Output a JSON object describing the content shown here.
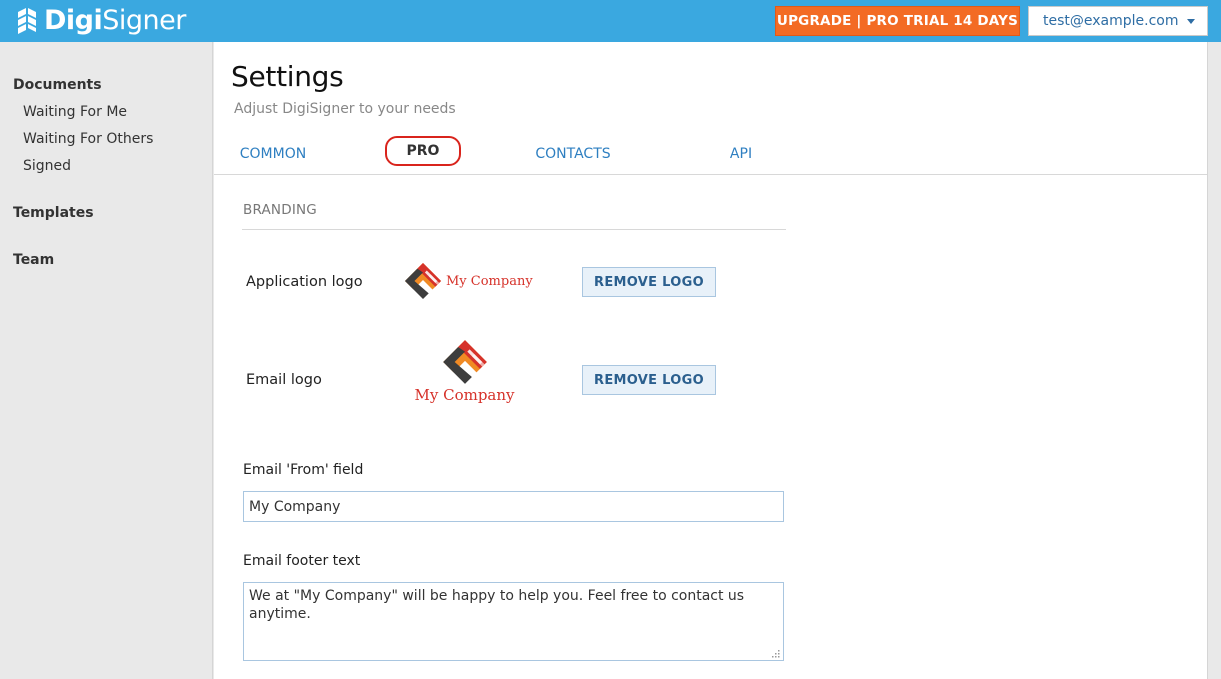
{
  "header": {
    "brand": {
      "bold": "Digi",
      "light": "Signer"
    },
    "upgrade_label": "UPGRADE | PRO TRIAL 14 DAYS",
    "user_email": "test@example.com"
  },
  "sidebar": {
    "documents": {
      "label": "Documents",
      "items": [
        "Waiting For Me",
        "Waiting For Others",
        "Signed"
      ]
    },
    "templates_label": "Templates",
    "team_label": "Team"
  },
  "main": {
    "title": "Settings",
    "subtitle": "Adjust DigiSigner to your needs",
    "tabs": [
      {
        "label": "COMMON",
        "active": false
      },
      {
        "label": "PRO",
        "active": true
      },
      {
        "label": "CONTACTS",
        "active": false
      },
      {
        "label": "API",
        "active": false
      }
    ],
    "branding": {
      "section_label": "BRANDING",
      "application_logo": {
        "label": "Application logo",
        "logo_text": "My Company",
        "button_label": "REMOVE LOGO"
      },
      "email_logo": {
        "label": "Email logo",
        "logo_text": "My Company",
        "button_label": "REMOVE LOGO"
      },
      "email_from": {
        "label": "Email 'From' field",
        "value": "My Company"
      },
      "email_footer": {
        "label": "Email footer text",
        "value": "We at \"My Company\" will be happy to help you. Feel free to contact us anytime."
      }
    }
  },
  "colors": {
    "header_bg": "#3aa8e0",
    "upgrade_bg": "#f36b24",
    "link_blue": "#2e7fc1",
    "active_tab_ring": "#d9241c",
    "logo_red": "#d6322a",
    "logo_orange": "#f08a24",
    "logo_dark": "#3d3d3d"
  },
  "icons": {
    "brand": "digisigner-logo-icon",
    "user_menu_caret": "chevron-down-icon",
    "company_logo": "diamond-logo-icon",
    "resize": "resize-grip-icon"
  }
}
